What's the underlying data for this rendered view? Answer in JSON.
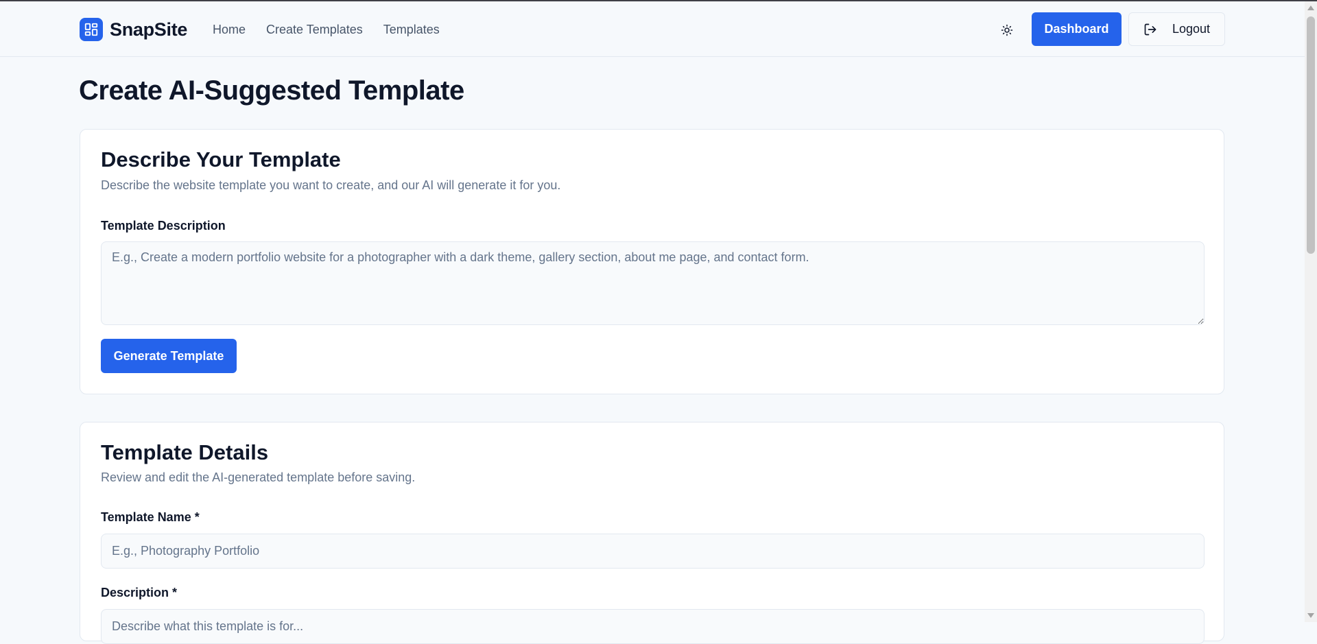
{
  "header": {
    "brand": "SnapSite",
    "nav": [
      "Home",
      "Create Templates",
      "Templates"
    ],
    "theme_toggle_icon": "sun-icon",
    "dashboard_label": "Dashboard",
    "logout_label": "Logout",
    "logout_icon": "logout-icon"
  },
  "page": {
    "title": "Create AI-Suggested Template"
  },
  "describe_card": {
    "title": "Describe Your Template",
    "subtitle": "Describe the website template you want to create, and our AI will generate it for you.",
    "field_label": "Template Description",
    "field_placeholder": "E.g., Create a modern portfolio website for a photographer with a dark theme, gallery section, about me page, and contact form.",
    "field_value": "",
    "generate_label": "Generate Template"
  },
  "details_card": {
    "title": "Template Details",
    "subtitle": "Review and edit the AI-generated template before saving.",
    "name_label": "Template Name *",
    "name_placeholder": "E.g., Photography Portfolio",
    "description_label": "Description *",
    "description_placeholder": "Describe what this template is for..."
  },
  "colors": {
    "accent": "#2563eb",
    "page_background": "#f6f9fc",
    "card_background": "#ffffff",
    "border": "#e2e8f0",
    "text_primary": "#0f172a",
    "text_muted": "#64748b"
  }
}
